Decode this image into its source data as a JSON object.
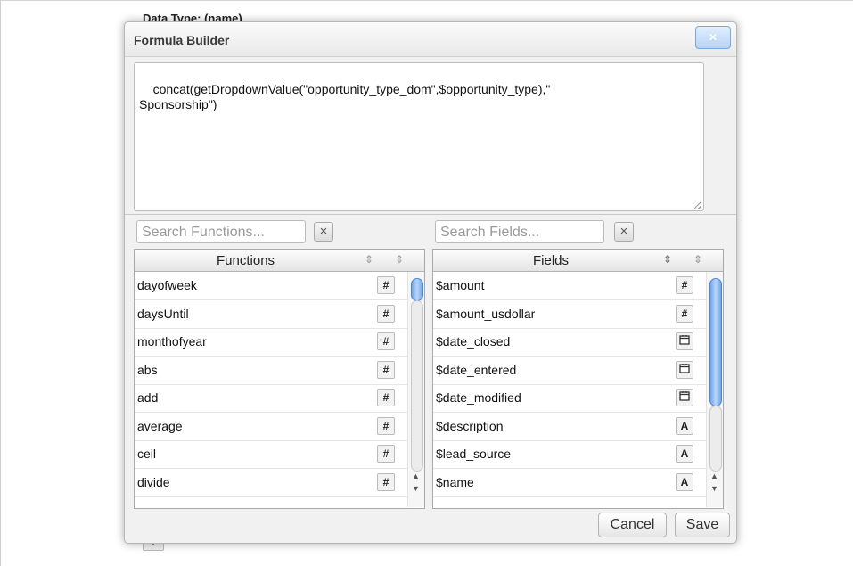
{
  "background": {
    "header_text": "Data Type: (name)"
  },
  "dialog": {
    "title": "Formula Builder",
    "close_label": "×",
    "formula": "concat(getDropdownValue(\"opportunity_type_dom\",$opportunity_type),\"\nSponsorship\")"
  },
  "functions": {
    "search_placeholder": "Search Functions...",
    "clear_label": "×",
    "header": "Functions",
    "rows": [
      {
        "name": "dayofweek",
        "type": "#"
      },
      {
        "name": "daysUntil",
        "type": "#"
      },
      {
        "name": "monthofyear",
        "type": "#"
      },
      {
        "name": "abs",
        "type": "#"
      },
      {
        "name": "add",
        "type": "#"
      },
      {
        "name": "average",
        "type": "#"
      },
      {
        "name": "ceil",
        "type": "#"
      },
      {
        "name": "divide",
        "type": "#"
      }
    ]
  },
  "fields": {
    "search_placeholder": "Search Fields...",
    "clear_label": "×",
    "header": "Fields",
    "rows": [
      {
        "name": "$amount",
        "type": "#"
      },
      {
        "name": "$amount_usdollar",
        "type": "#"
      },
      {
        "name": "$date_closed",
        "type": "date"
      },
      {
        "name": "$date_entered",
        "type": "date"
      },
      {
        "name": "$date_modified",
        "type": "date"
      },
      {
        "name": "$description",
        "type": "A"
      },
      {
        "name": "$lead_source",
        "type": "A"
      },
      {
        "name": "$name",
        "type": "A"
      }
    ]
  },
  "buttons": {
    "cancel": "Cancel",
    "save": "Save"
  },
  "icons": {
    "sort": "sort-icon",
    "calendar": "calendar-icon",
    "number": "number-icon",
    "text": "text-icon"
  },
  "colors": {
    "accent": "#6ea7ea",
    "close_border": "#7aa9df"
  }
}
